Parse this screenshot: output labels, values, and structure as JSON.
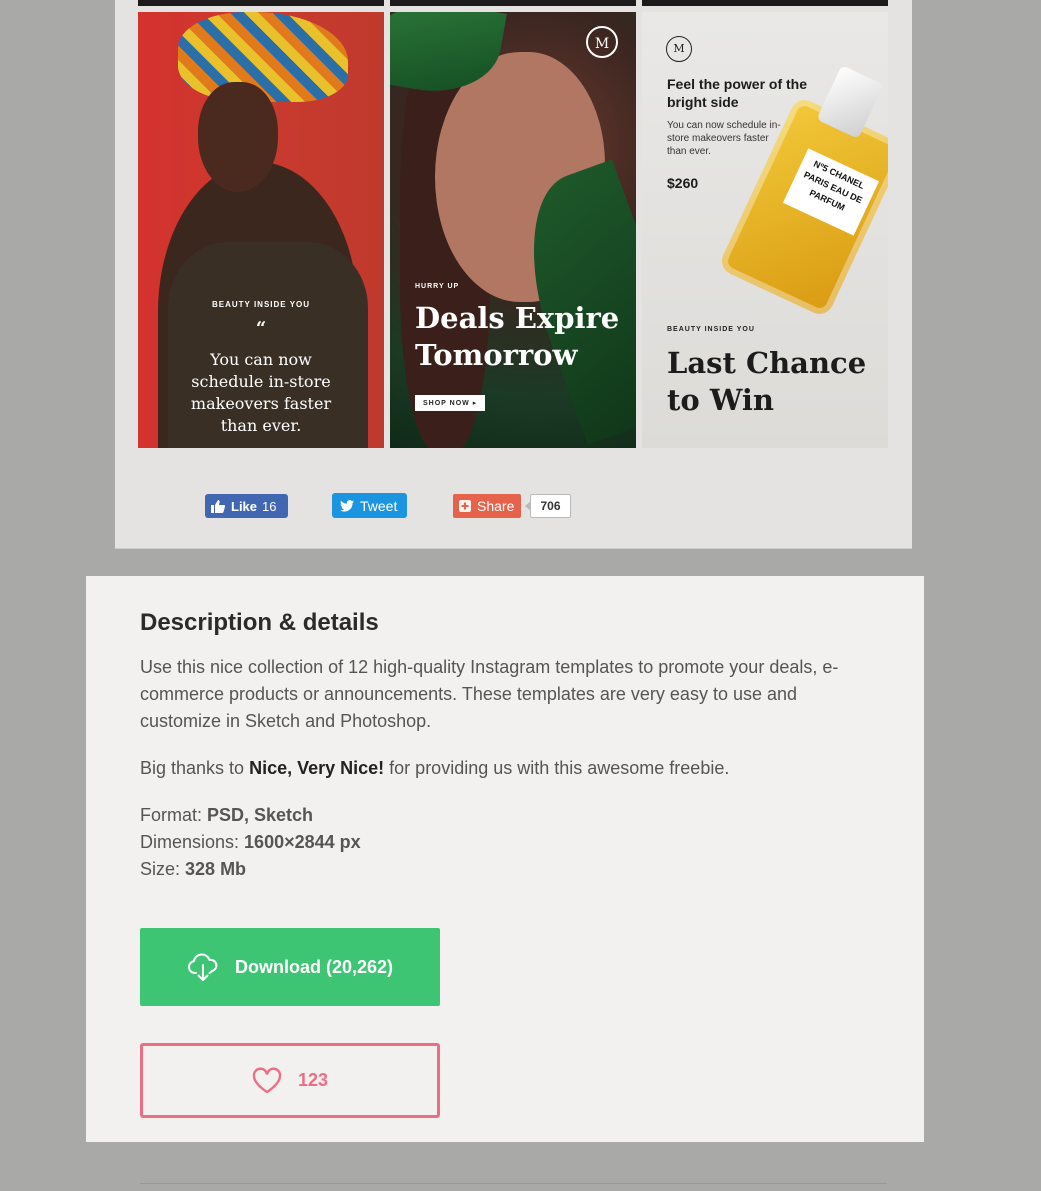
{
  "tiles": {
    "tile1": {
      "kicker": "BEAUTY INSIDE YOU",
      "quote_mark": "“",
      "body": "You can now schedule in-store makeovers faster than ever."
    },
    "tile2": {
      "logo": "M",
      "kicker": "HURRY UP",
      "title": "Deals Expire Tomorrow",
      "button": "SHOP NOW"
    },
    "tile3": {
      "logo": "M",
      "heading": "Feel the power of the bright side",
      "sub": "You can now schedule in-store makeovers faster than ever.",
      "price": "$260",
      "bottle_label": "Nº5 CHANEL PARIS EAU DE PARFUM",
      "kicker": "BEAUTY INSIDE YOU",
      "title": "Last Chance to Win"
    }
  },
  "share": {
    "like_label": "Like",
    "like_count": "16",
    "tweet_label": "Tweet",
    "share_label": "Share",
    "share_count": "706"
  },
  "description": {
    "title": "Description & details",
    "paragraph": "Use this nice collection of 12 high-quality Instagram templates to promote your deals, e-commerce products or announcements. These templates are very easy to use and customize in Sketch and Photoshop.",
    "thanks_prefix": "Big thanks to ",
    "thanks_author": "Nice, Very Nice!",
    "thanks_suffix": " for providing us with this awesome freebie.",
    "format_label": "Format: ",
    "format_value": "PSD, Sketch",
    "dimensions_label": "Dimensions: ",
    "dimensions_value": "1600×2844 px",
    "size_label": "Size: ",
    "size_value": "328 Mb"
  },
  "actions": {
    "download_label": "Download (20,262)",
    "likes_count": "123"
  },
  "colors": {
    "download_bg": "#3ec574",
    "like_border": "#ec6e85",
    "facebook": "#4267b2",
    "twitter": "#1b95e0",
    "share": "#e5634a"
  },
  "icons": [
    "thumbs-up-icon",
    "twitter-bird-icon",
    "plus-square-icon",
    "cloud-download-icon",
    "heart-icon"
  ]
}
